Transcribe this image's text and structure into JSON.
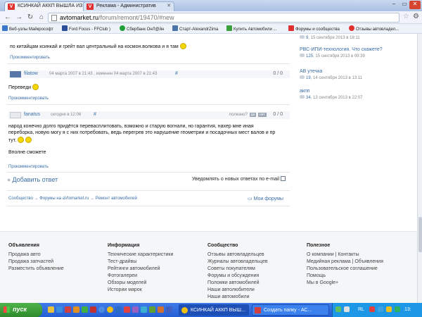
{
  "browser": {
    "tabs": [
      {
        "label": "КСИНКАЙ АККП ВЫШЛА ИЗ",
        "active": true
      },
      {
        "label": "Реклама - Административ",
        "active": false
      }
    ],
    "url_host": "avtomarket.ru",
    "url_path": "/forum/remont/19470/#new",
    "bookmarks": [
      "Веб-узлы Майкрософт",
      "Ford Focus - FFClub )",
      "Сбербанк ОнЛ@йн",
      "Старт-AlexandrZima",
      "Купить Автомобили ...",
      "Форумы и сообщества",
      "Отзывы автовладел..."
    ]
  },
  "comments": [
    {
      "text": "по китайцам ксинкай и грейт вал центральный на космон.волкова и я там",
      "reply_label": "Прокомментировать"
    },
    {
      "author": "filatow",
      "date": "04 марта 2007 в 21:43 , изменен 04 марта 2007 в 21:43",
      "anchor": "#",
      "score": "0 / 0",
      "text": "Переведи",
      "reply_label": "Прокомментировать"
    },
    {
      "author": "fanatus",
      "date": "сегодня в 12:06",
      "anchor": "#",
      "useful_label": "полезно?",
      "vote_yes": "да",
      "vote_no": "нет",
      "score": "0 / 0",
      "text_line1": "народ конечно долго придётся перевасплитовать, взможно и старую вогнали, но гарантия, нахер мне иная",
      "text_line2": "переборка, новую могу я с них потребовать, ведь перегрев это нарушение геометрии и посадочных мест валов и пр",
      "text_line3": "тут.",
      "text_line4": "Вполне сможете",
      "reply_label": "Прокомментировать"
    }
  ],
  "add_answer_label": "Добавить ответ",
  "notify_label": "Уведомлять о новых ответах по e-mail",
  "breadcrumbs": "Сообщество → Форумы на aVtomarket.ru → Ремонт автомобилей",
  "my_forums_label": "Мои форумы",
  "sidebar_topics": [
    {
      "title": "",
      "count": "9",
      "date": ", 15 сентября 2013 в 18:11"
    },
    {
      "title": "РВС-ИПИ-технология. Что скажете?",
      "count": "125",
      "date": ", 15 сентября 2013 в 09:39"
    },
    {
      "title": "АВ утечка",
      "count": "19",
      "date": ", 14 сентября 2013 в 13:11"
    },
    {
      "title": "акпп",
      "count": "34",
      "date": ", 13 сентября 2013 в 22:07"
    }
  ],
  "footer": {
    "columns": [
      {
        "heading": "Объявления",
        "items": [
          "Продажа авто",
          "Продажа запчастей",
          "Разместить объявление"
        ]
      },
      {
        "heading": "Информация",
        "items": [
          "Технические характеристики",
          "Тест-драйвы",
          "Рейтинги автомобилей",
          "Фотогалереи",
          "Обзоры моделей",
          "Истории марок"
        ]
      },
      {
        "heading": "Сообщество",
        "items": [
          "Отзывы автовладельцев",
          "Журналы автовладельцев",
          "Советы покупателям",
          "Форумы и обсуждения",
          "Поломки автомобилей",
          "Наши автолюбители",
          "Наши автомобили"
        ]
      },
      {
        "heading": "Полезное",
        "items": [
          "О компании | Контакты",
          "Медийная реклама | Объявления",
          "Пользовательское соглашение",
          "Помощь",
          "Мы в Google+"
        ]
      }
    ]
  },
  "taskbar": {
    "start_label": "пуск",
    "windows": [
      "КСИНКАЙ АККП ВЫШ...",
      "Создать папку - АС..."
    ],
    "lang": "RL",
    "clock": "13:"
  }
}
